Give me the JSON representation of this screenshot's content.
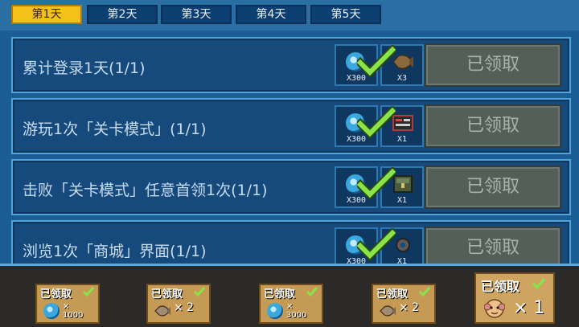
{
  "tabs": [
    "第1天",
    "第2天",
    "第3天",
    "第4天",
    "第5天"
  ],
  "active_tab": 0,
  "tasks": [
    {
      "label": "累计登录1天(1/1)",
      "reward1_qty": "X300",
      "reward2_qty": "X3",
      "reward2_icon": "fish-icon",
      "button": "已领取"
    },
    {
      "label": "游玩1次「关卡模式」(1/1)",
      "reward1_qty": "X300",
      "reward2_qty": "X1",
      "reward2_icon": "card-icon",
      "button": "已领取"
    },
    {
      "label": "击败「关卡模式」任意首领1次(1/1)",
      "reward1_qty": "X300",
      "reward2_qty": "X1",
      "reward2_icon": "chest-icon",
      "button": "已领取"
    },
    {
      "label": "浏览1次「商城」界面(1/1)",
      "reward1_qty": "X300",
      "reward2_qty": "X1",
      "reward2_icon": "gear-icon",
      "button": "已领取"
    }
  ],
  "milestones": [
    {
      "title": "已领取",
      "qty_prefix": "×",
      "qty": "1000",
      "icon": "coin-icon"
    },
    {
      "title": "已领取",
      "qty": "× 2",
      "icon": "fish-icon"
    },
    {
      "title": "已领取",
      "qty_prefix": "×",
      "qty": "3000",
      "icon": "coin-icon"
    },
    {
      "title": "已领取",
      "qty": "× 2",
      "icon": "fish-icon"
    },
    {
      "title": "已领取",
      "qty": "× 1",
      "icon": "monkey-icon"
    }
  ],
  "colors": {
    "active_tab": "#f2c21a",
    "check": "#8be34a",
    "claimed_button": "#53605a",
    "coin": "#3aa7dd"
  }
}
